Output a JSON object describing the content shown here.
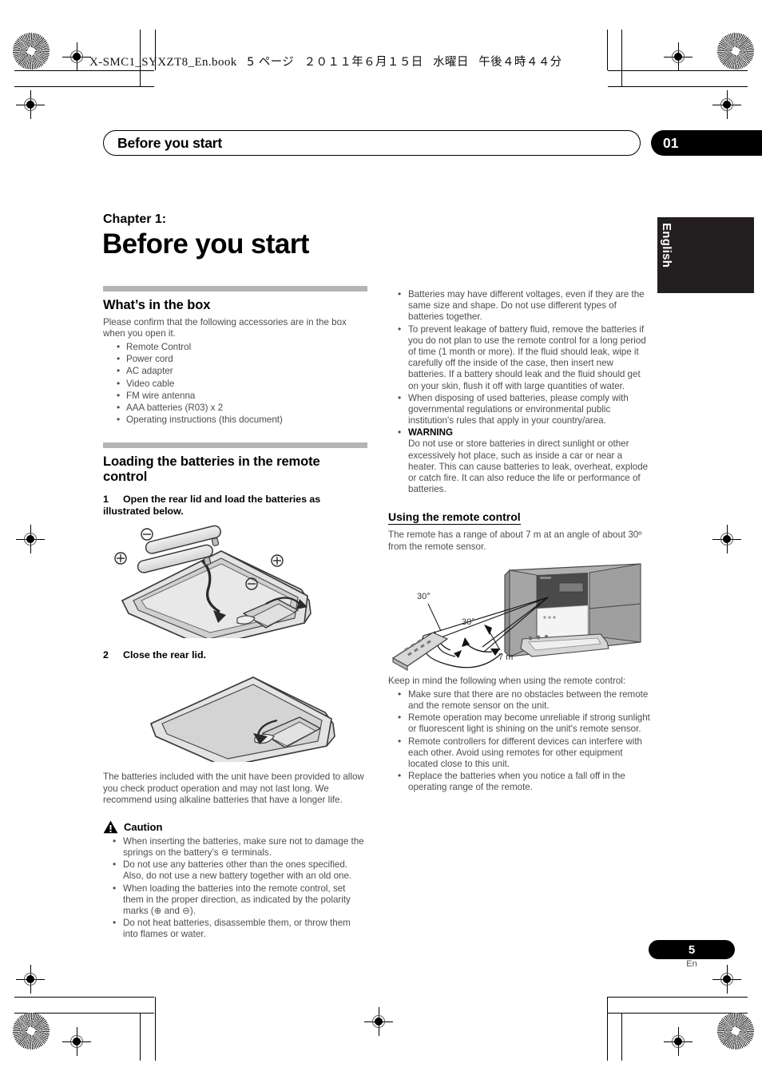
{
  "print_header": {
    "filename": "X-SMC1_SYXZT8_En.book",
    "page_ref": "5 ページ",
    "date": "２０１１年６月１５日",
    "weekday": "水曜日",
    "time": "午後４時４４分"
  },
  "running_head": {
    "title": "Before you start",
    "chapter_number": "01"
  },
  "language_tab": {
    "label": "English"
  },
  "chapter": {
    "label": "Chapter 1:",
    "title": "Before you start"
  },
  "left_column": {
    "section_whats_in_box": {
      "heading": "What’s in the box",
      "intro": "Please confirm that the following accessories are in the box when you open it.",
      "items": [
        "Remote Control",
        "Power cord",
        "AC adapter",
        "Video cable",
        "FM wire antenna",
        "AAA batteries (R03) x 2",
        "Operating instructions (this document)"
      ]
    },
    "section_loading_batteries": {
      "heading": "Loading the batteries in the remote control",
      "step1_num": "1",
      "step1_text": "Open the rear lid and load the batteries as illustrated below.",
      "figure1_alt": "remote-control-open-rear-lid-batteries",
      "figure1_marks": [
        "⊖",
        "⊕",
        "⊕",
        "⊖"
      ],
      "step2_num": "2",
      "step2_text": "Close the rear lid.",
      "figure2_alt": "remote-control-closed-rear-lid",
      "note": "The batteries included with the unit have been provided to allow you check product operation and may not last long. We recommend using alkaline batteries that have a longer life."
    },
    "caution": {
      "title": "Caution",
      "items": [
        "When inserting the batteries, make sure not to damage the springs on the battery's ⊖ terminals.",
        "Do not use any batteries other than the ones specified. Also, do not use a new battery together with an old one.",
        "When loading the batteries into the remote control, set them in the proper direction, as indicated by the polarity marks (⊕ and ⊖).",
        "Do not heat batteries, disassemble them, or throw them into flames or water."
      ]
    }
  },
  "right_column": {
    "battery_notes": [
      "Batteries may have different voltages, even if they are the same size and shape. Do not use different types of batteries together.",
      "To prevent leakage of battery fluid, remove the batteries if you do not plan to use the remote control for a long period of time (1 month or more). If the fluid should leak, wipe it carefully off the inside of the case, then insert new batteries. If a battery should leak and the fluid should get on your skin, flush it off with large quantities of water.",
      "When disposing of used batteries, please comply with governmental regulations or environmental public institution's rules that apply in your country/area."
    ],
    "warning": {
      "label": "WARNING",
      "text": "Do not use or store batteries in direct sunlight or other excessively hot place, such as inside a car or near a heater. This can cause batteries to leak, overheat, explode or catch fire. It can also reduce the life or performance of batteries."
    },
    "using_remote": {
      "heading": "Using the remote control",
      "intro": "The remote has a range of about 7 m at an angle of about 30º from the remote sensor.",
      "figure_alt": "remote-control-operating-range-diagram",
      "figure_labels": {
        "angle_top": "30°",
        "angle_inner": "30°",
        "distance": "7 m"
      },
      "lead_in": "Keep in mind the following when using the remote control:",
      "items": [
        "Make sure that there are no obstacles between the remote and the remote sensor on the unit.",
        "Remote operation may become unreliable if strong sunlight or fluorescent light is shining on the unit's remote sensor.",
        "Remote controllers for different devices can interfere with each other. Avoid using remotes for other equipment located close to this unit.",
        "Replace the batteries when you notice a fall off in the operating range of the remote."
      ]
    }
  },
  "footer": {
    "page_number": "5",
    "language_code": "En"
  },
  "colors": {
    "accent_black": "#000000",
    "rule_gray": "#b4b4b4",
    "body_gray": "#4d4d4d",
    "tab_dark": "#231f20"
  }
}
